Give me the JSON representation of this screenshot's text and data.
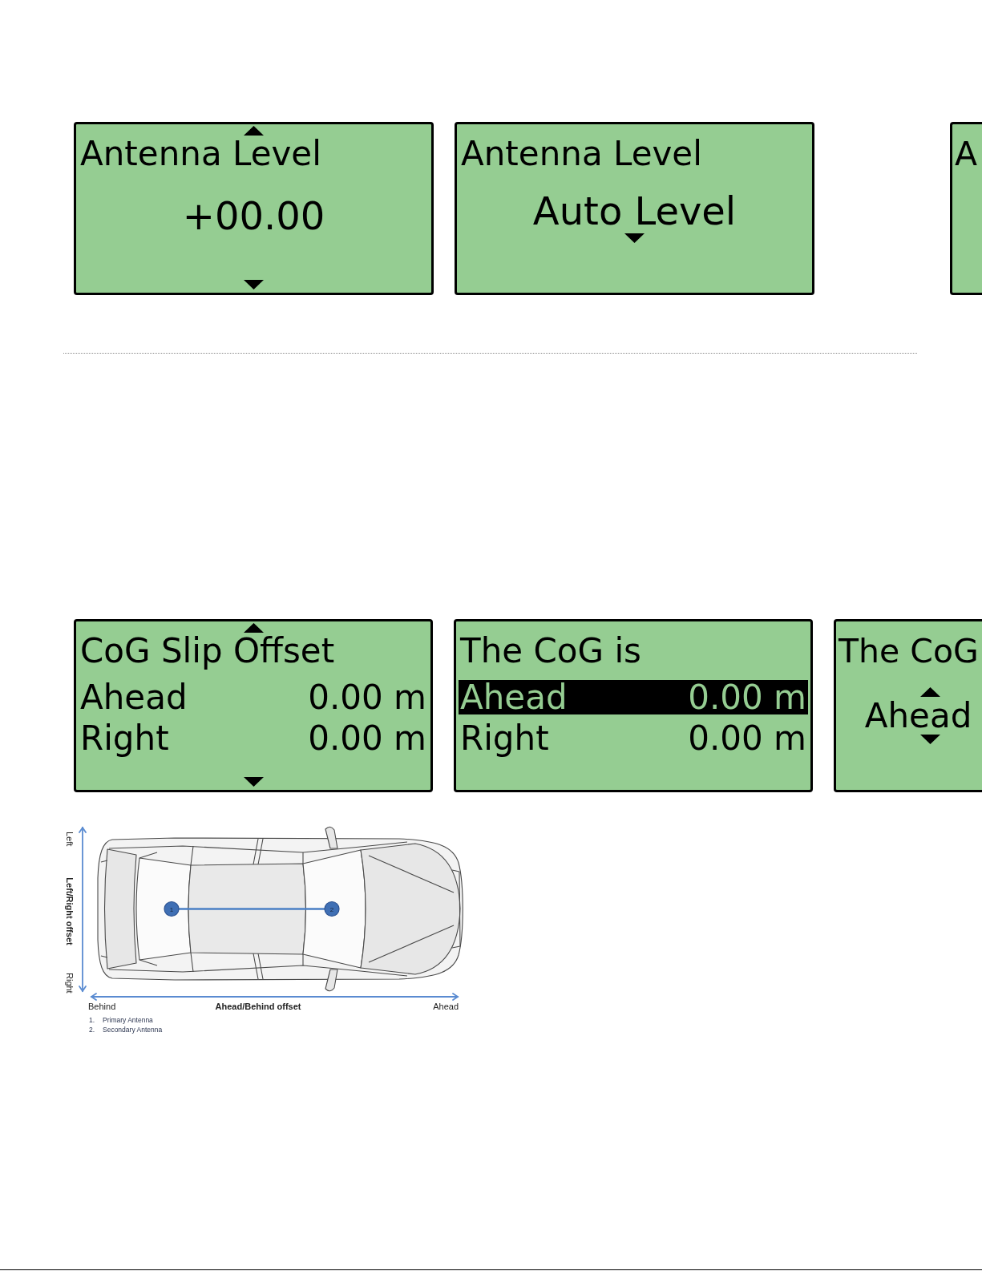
{
  "top_row": {
    "screens": [
      {
        "kind": "value",
        "title": "Antenna Level",
        "value": "+00.00",
        "scroll_up": true,
        "scroll_down": true
      },
      {
        "kind": "picker",
        "title": "Antenna Level",
        "value": "Auto Level",
        "up_arrow": false,
        "down_arrow": true
      },
      {
        "kind": "value",
        "title": "A"
      }
    ]
  },
  "bottom_row": {
    "screens": [
      {
        "kind": "list",
        "title": "CoG Slip Offset",
        "rows": [
          {
            "label": "Ahead",
            "value": "0.00 m",
            "selected": false
          },
          {
            "label": "Right",
            "value": "0.00 m",
            "selected": false
          }
        ],
        "scroll_up": true,
        "scroll_down": true
      },
      {
        "kind": "list",
        "title": "The CoG is",
        "rows": [
          {
            "label": "Ahead",
            "value": "0.00 m",
            "selected": true
          },
          {
            "label": "Right",
            "value": "0.00 m",
            "selected": false
          }
        ],
        "scroll_up": false,
        "scroll_down": false
      },
      {
        "kind": "picker",
        "title": "The CoG",
        "value": "Ahead",
        "up_arrow": true,
        "down_arrow": true
      }
    ]
  },
  "diagram": {
    "vertical_axis": {
      "start_label": "Left",
      "title": "Left/Right offset",
      "end_label": "Right"
    },
    "horizontal_axis": {
      "start_label": "Behind",
      "title": "Ahead/Behind offset",
      "end_label": "Ahead"
    },
    "antennas": [
      {
        "marker": "1"
      },
      {
        "marker": "2"
      }
    ],
    "legend": [
      {
        "number": "1.",
        "label": "Primary Antenna"
      },
      {
        "number": "2.",
        "label": "Secondary Antenna"
      }
    ]
  }
}
